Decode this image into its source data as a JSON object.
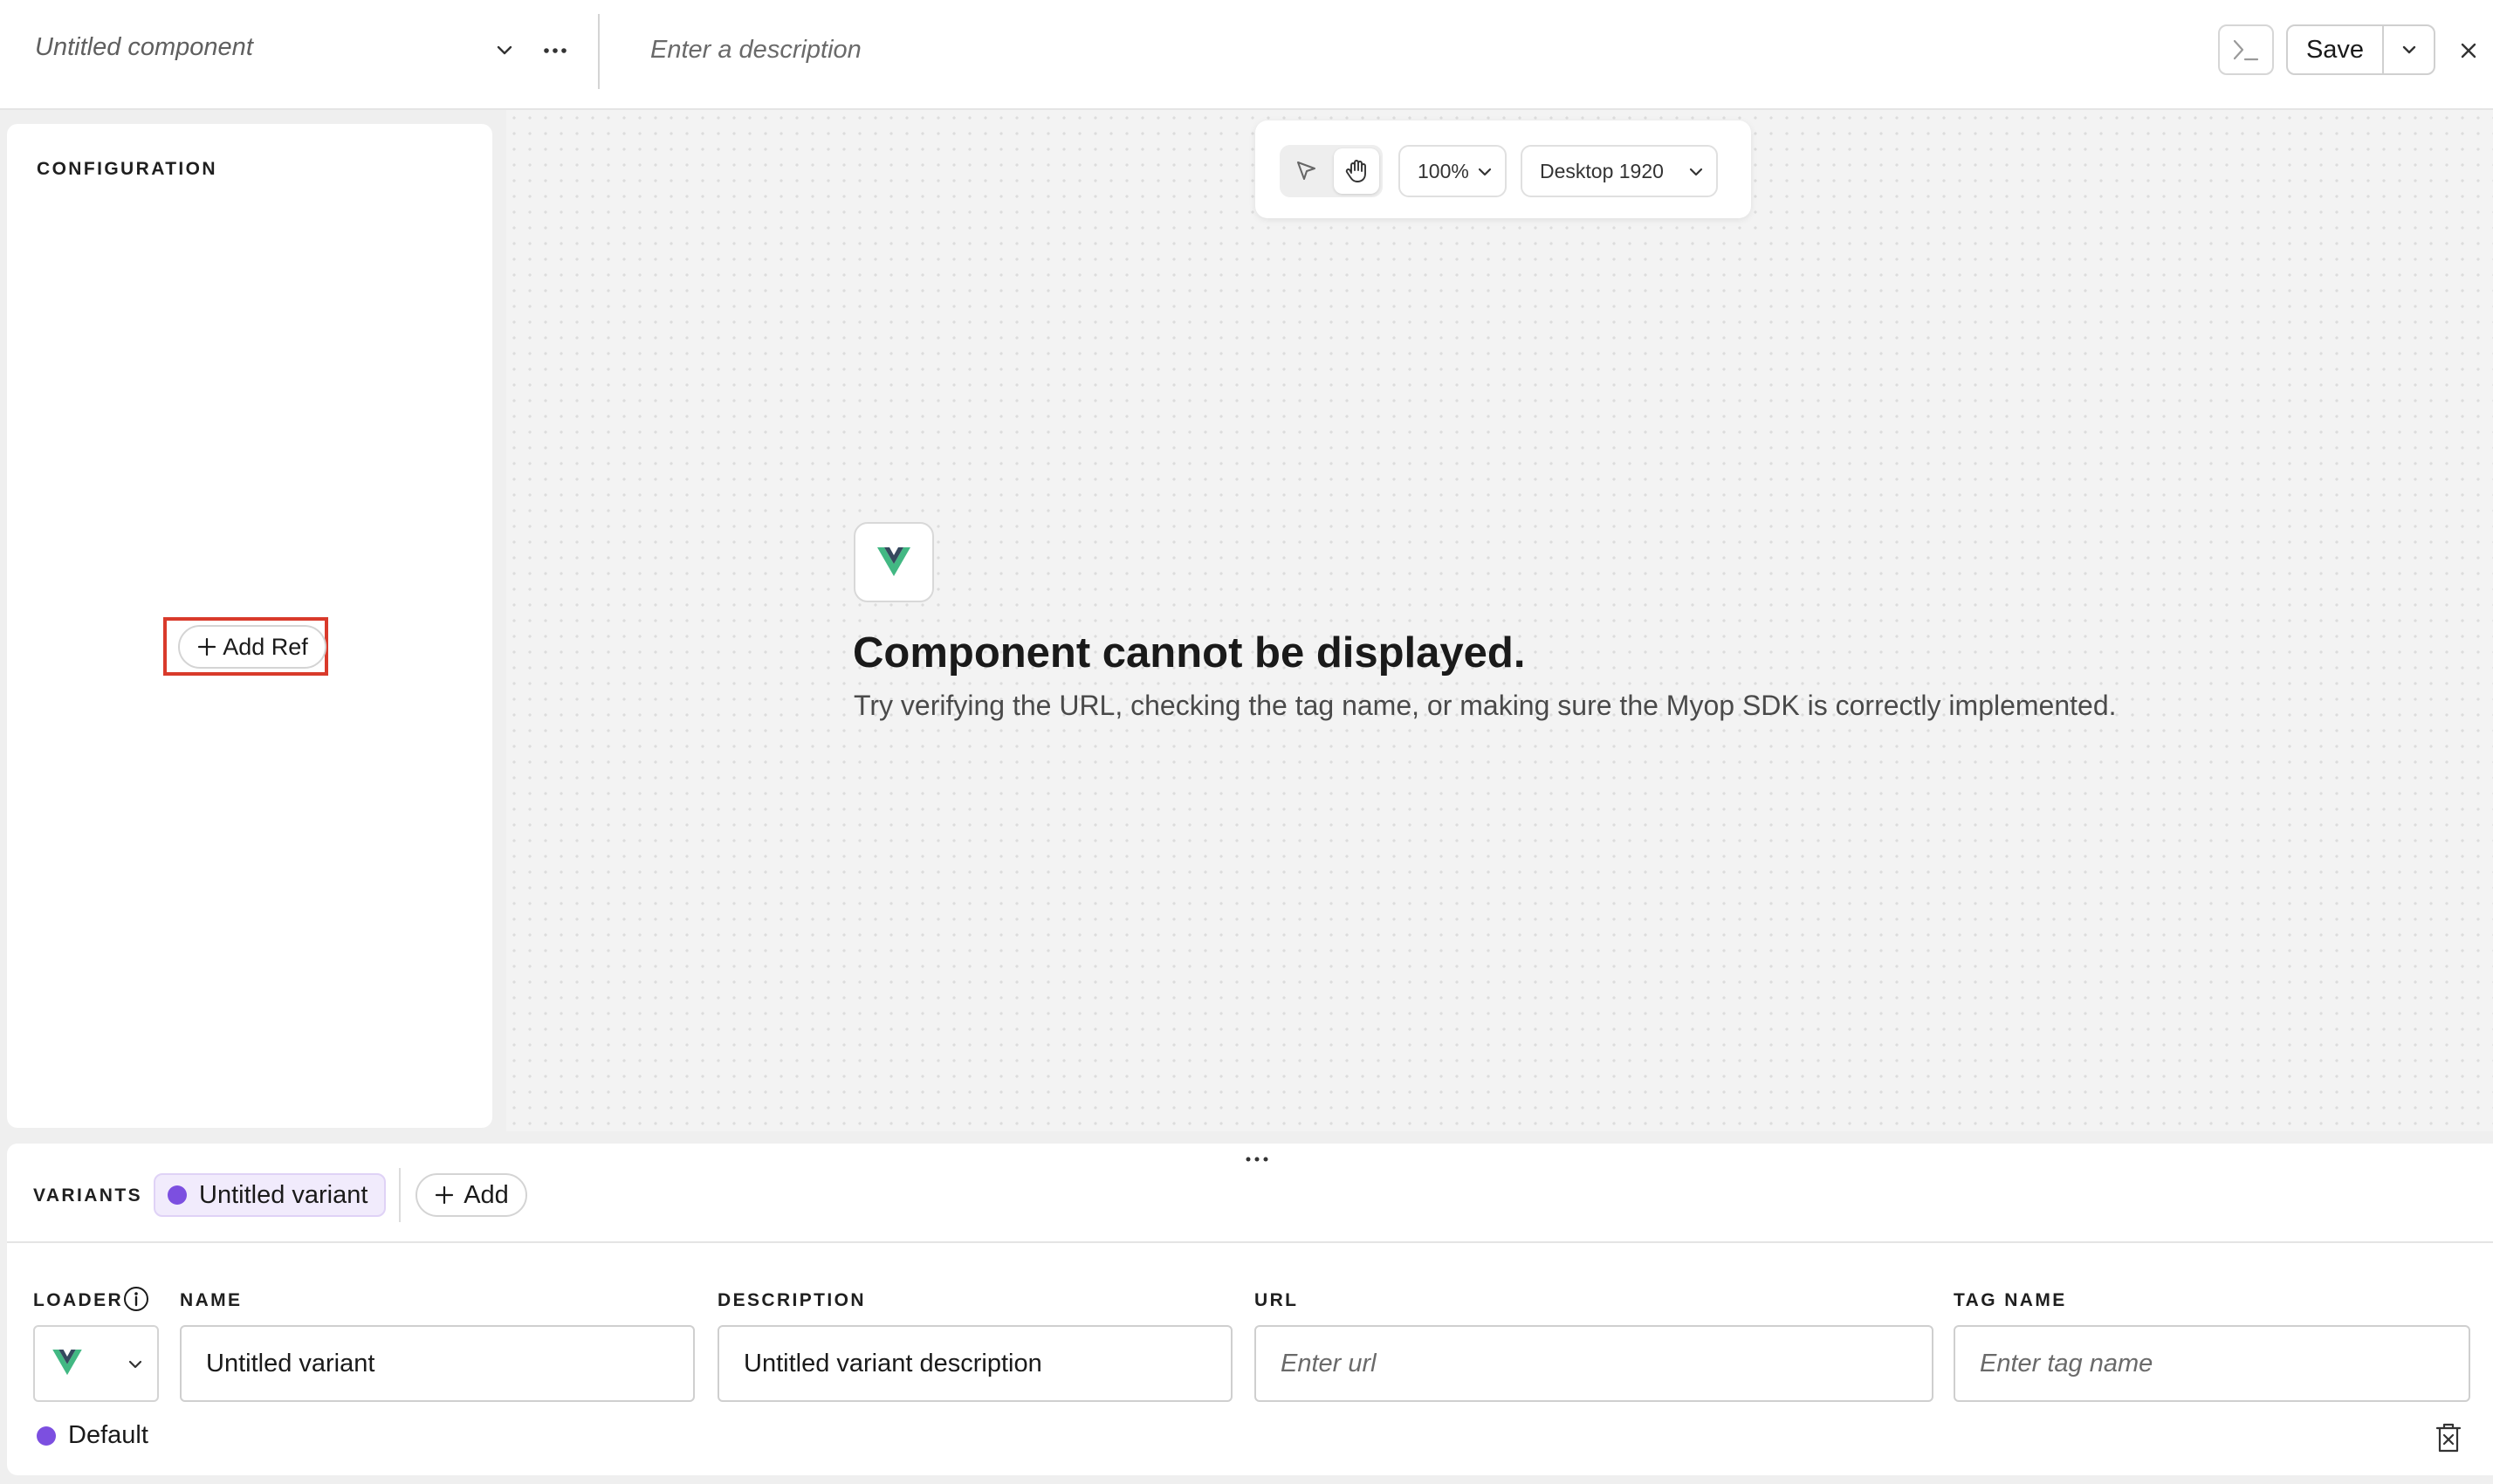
{
  "header": {
    "component_name": "Untitled component",
    "description_placeholder": "Enter a description",
    "save_label": "Save"
  },
  "config": {
    "title": "CONFIGURATION",
    "add_ref_label": "Add Ref"
  },
  "canvas": {
    "zoom": "100%",
    "device": "Desktop 1920",
    "error_title": "Component cannot be displayed.",
    "error_description": "Try verifying the URL, checking the tag name, or making sure the Myop SDK is correctly implemented."
  },
  "variants": {
    "label": "VARIANTS",
    "items": [
      {
        "name": "Untitled variant",
        "color": "#7c4fe0"
      }
    ],
    "add_label": "Add",
    "fields": {
      "loader_label": "LOADER",
      "name_label": "NAME",
      "name_value": "Untitled variant",
      "description_label": "DESCRIPTION",
      "description_value": "Untitled variant description",
      "url_label": "URL",
      "url_placeholder": "Enter url",
      "tag_label": "TAG NAME",
      "tag_placeholder": "Enter tag name"
    },
    "default_label": "Default"
  },
  "colors": {
    "accent_purple": "#7c4fe0",
    "highlight_red": "#d93a2b",
    "vue_green": "#42b883",
    "vue_dark": "#35495e"
  }
}
